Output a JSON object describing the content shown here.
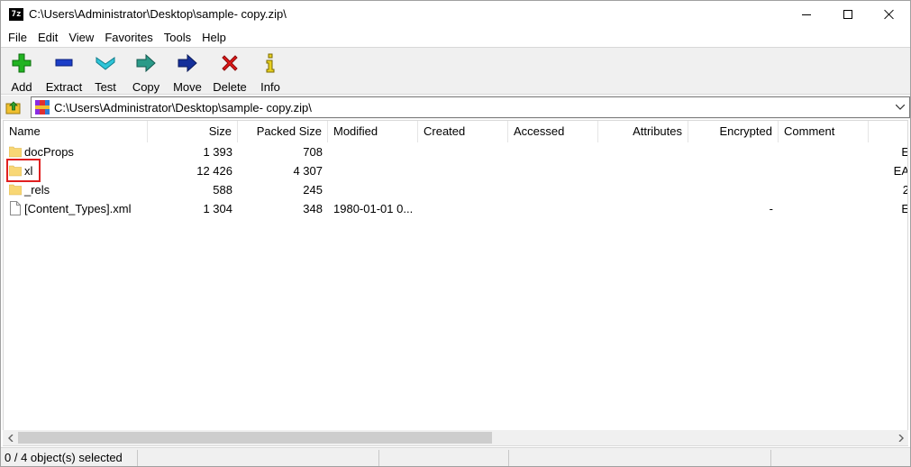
{
  "window": {
    "app_icon_text": "7z",
    "title": "C:\\Users\\Administrator\\Desktop\\sample- copy.zip\\"
  },
  "menu": [
    "File",
    "Edit",
    "View",
    "Favorites",
    "Tools",
    "Help"
  ],
  "toolbar": {
    "add_label": "Add",
    "extract_label": "Extract",
    "test_label": "Test",
    "copy_label": "Copy",
    "move_label": "Move",
    "delete_label": "Delete",
    "info_label": "Info"
  },
  "address": {
    "path": "C:\\Users\\Administrator\\Desktop\\sample- copy.zip\\"
  },
  "columns": {
    "name": "Name",
    "size": "Size",
    "packed_size": "Packed Size",
    "modified": "Modified",
    "created": "Created",
    "accessed": "Accessed",
    "attributes": "Attributes",
    "encrypted": "Encrypted",
    "comment": "Comment"
  },
  "rows": [
    {
      "name": "docProps",
      "type": "folder",
      "size": "1 393",
      "packed": "708",
      "modified": "",
      "encrypted": "",
      "overflow": "E"
    },
    {
      "name": "xl",
      "type": "folder",
      "size": "12 426",
      "packed": "4 307",
      "modified": "",
      "encrypted": "",
      "overflow": "EA"
    },
    {
      "name": "_rels",
      "type": "folder",
      "size": "588",
      "packed": "245",
      "modified": "",
      "encrypted": "",
      "overflow": "2"
    },
    {
      "name": "[Content_Types].xml",
      "type": "file",
      "size": "1 304",
      "packed": "348",
      "modified": "1980-01-01 0...",
      "encrypted": "-",
      "overflow": "E"
    }
  ],
  "status": {
    "text": "0 / 4 object(s) selected"
  },
  "colors": {
    "folder": "#f8d775",
    "highlight": "#e02020",
    "add": "#21b321",
    "extract": "#1c3ec8",
    "test": "#2ec5d8",
    "delete": "#e01818",
    "info": "#e8d020"
  }
}
